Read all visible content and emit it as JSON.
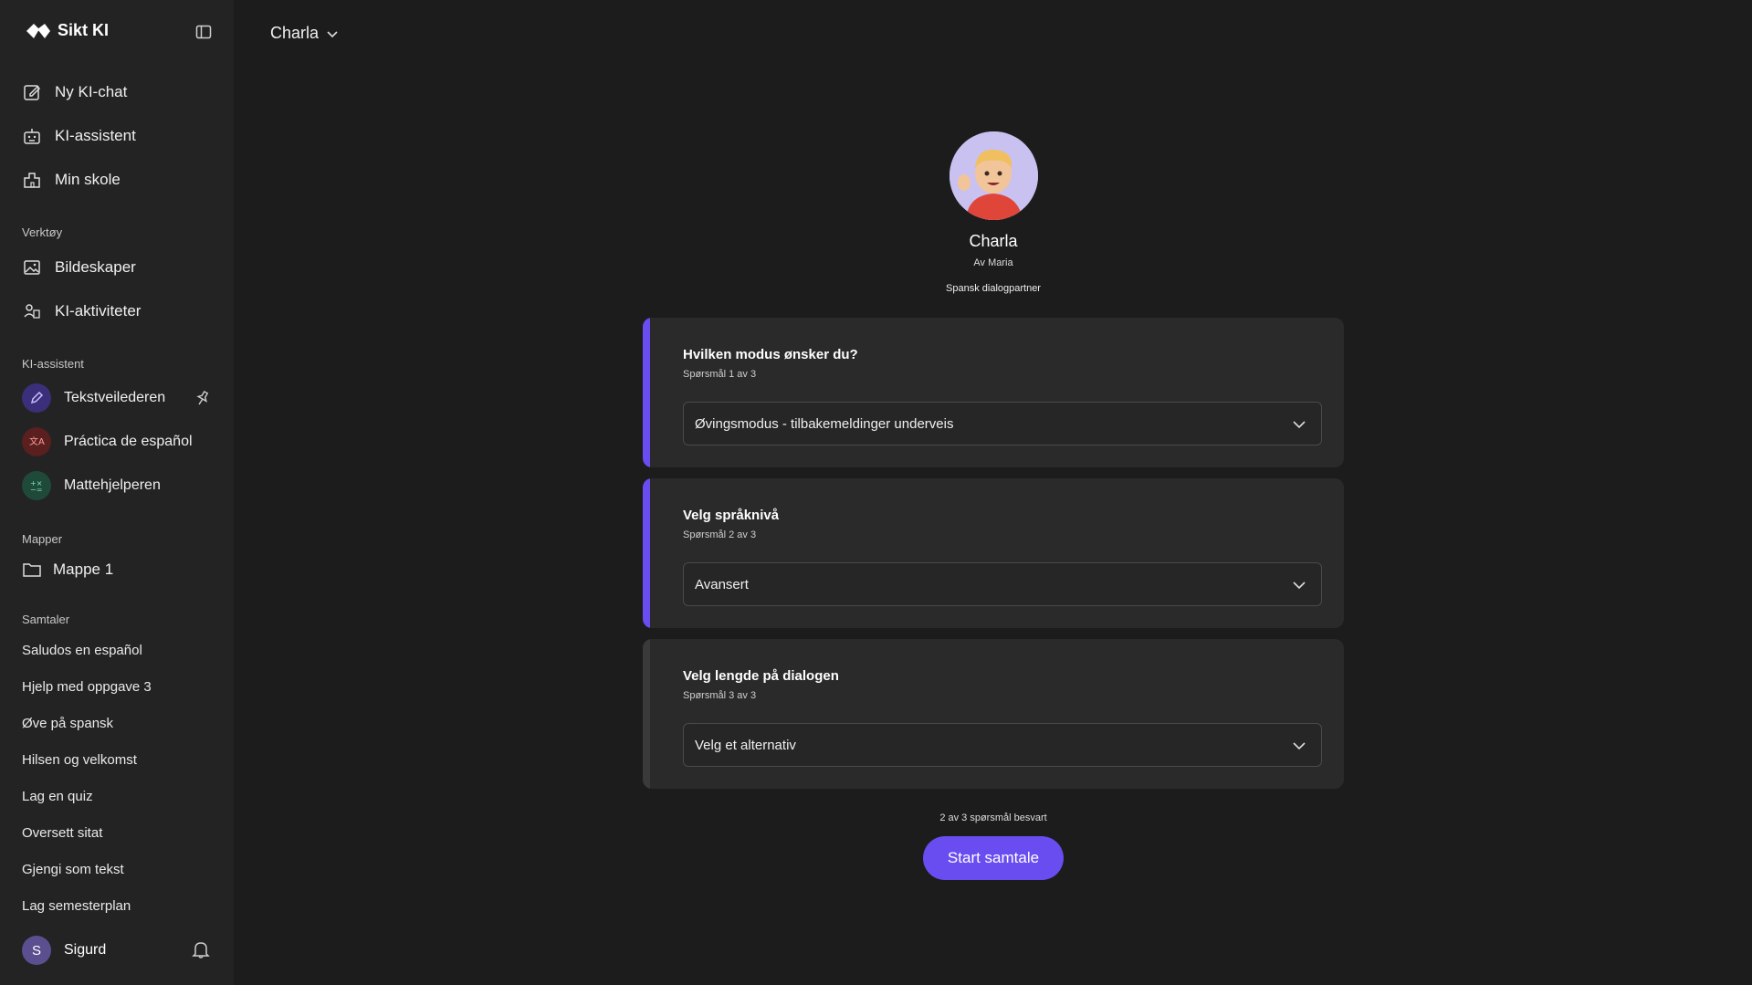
{
  "brand": {
    "name": "Sikt KI"
  },
  "sidebar": {
    "main_nav": [
      {
        "label": "Ny KI-chat",
        "icon": "edit-icon"
      },
      {
        "label": "KI-assistent",
        "icon": "robot-icon"
      },
      {
        "label": "Min skole",
        "icon": "school-icon"
      }
    ],
    "tools_label": "Verktøy",
    "tools": [
      {
        "label": "Bildeskaper",
        "icon": "image-icon"
      },
      {
        "label": "KI-aktiviteter",
        "icon": "activities-icon"
      }
    ],
    "assistants_label": "KI-assistent",
    "assistants": [
      {
        "label": "Tekstveilederen",
        "icon": "pencil-icon",
        "color": "#3a2f7a"
      },
      {
        "label": "Práctica de español",
        "icon": "translate-icon",
        "color": "#5a1f1f"
      },
      {
        "label": "Mattehjelperen",
        "icon": "math-icon",
        "color": "#1f4a3a"
      }
    ],
    "folders_label": "Mapper",
    "folders": [
      {
        "label": "Mappe 1",
        "icon": "folder-icon"
      }
    ],
    "conversations_label": "Samtaler",
    "conversations": [
      "Saludos en español",
      "Hjelp med oppgave 3",
      "Øve på spansk",
      "Hilsen og velkomst",
      "Lag en quiz",
      "Oversett sitat",
      "Gjengi som tekst",
      "Lag semesterplan"
    ],
    "user": {
      "initial": "S",
      "name": "Sigurd"
    }
  },
  "header": {
    "assistant_select": "Charla"
  },
  "profile": {
    "name": "Charla",
    "author": "Av Maria",
    "description": "Spansk dialogpartner"
  },
  "questions": [
    {
      "title": "Hvilken modus ønsker du?",
      "sub": "Spørsmål 1 av 3",
      "value": "Øvingsmodus - tilbakemeldinger underveis",
      "answered": true
    },
    {
      "title": "Velg språknivå",
      "sub": "Spørsmål 2 av 3",
      "value": "Avansert",
      "answered": true
    },
    {
      "title": "Velg lengde på dialogen",
      "sub": "Spørsmål 3 av 3",
      "value": "Velg et alternativ",
      "answered": false
    }
  ],
  "progress": "2 av 3 spørsmål besvart",
  "start_button": "Start samtale",
  "colors": {
    "accent": "#6a4df0",
    "answered_bar": "#6a4df0",
    "unanswered_bar": "#3a3a3a"
  }
}
